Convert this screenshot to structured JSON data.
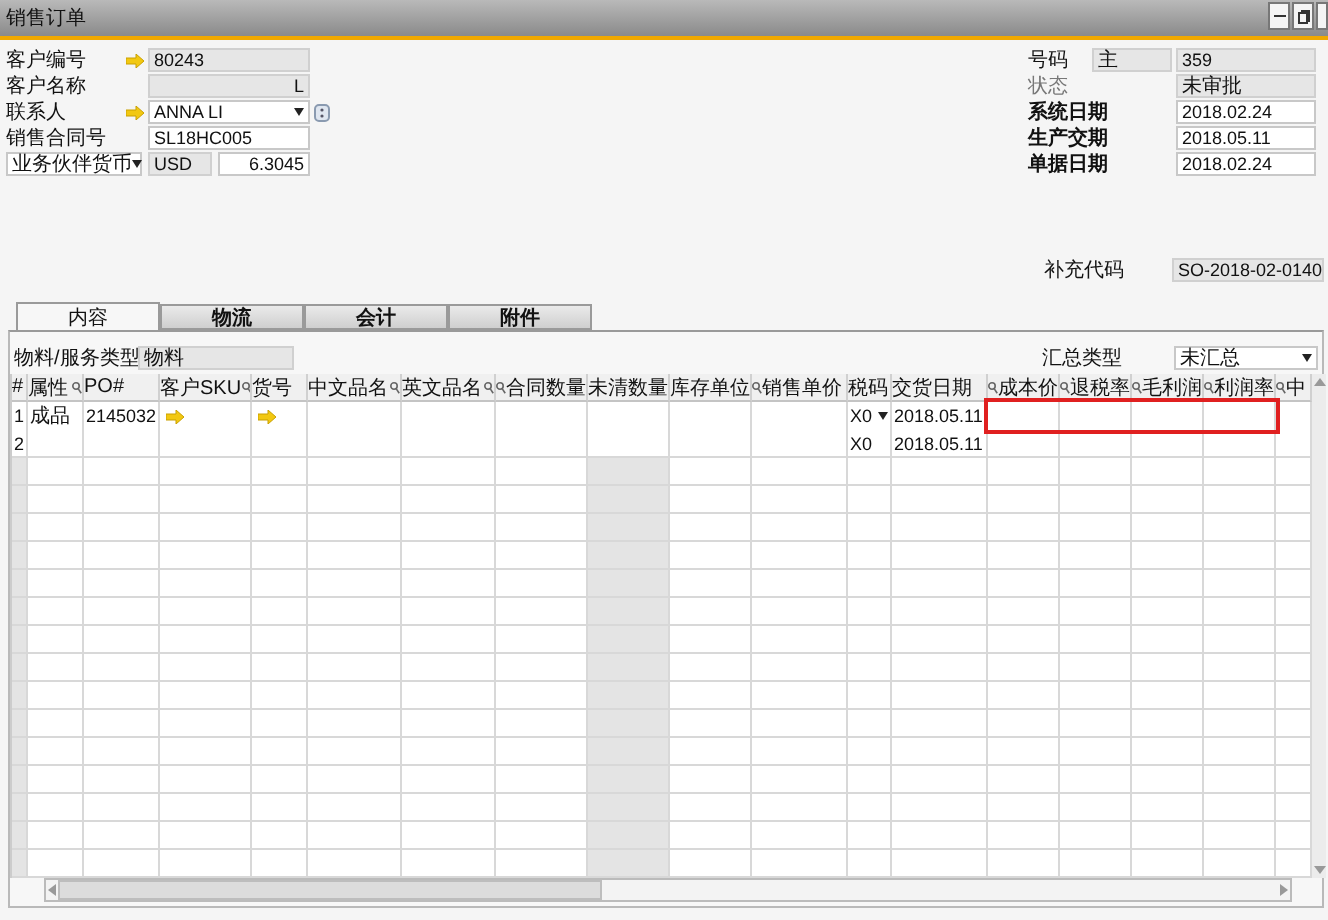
{
  "window": {
    "title": "销售订单"
  },
  "left_fields": [
    {
      "label": "客户编号",
      "kind": "link",
      "value": "80243"
    },
    {
      "label": "客户名称",
      "kind": "readonly_right",
      "value": "L"
    },
    {
      "label": "联系人",
      "kind": "link_dropdown",
      "value": "ANNA LI"
    },
    {
      "label": "销售合同号",
      "kind": "input",
      "value": "SL18HC005"
    },
    {
      "label": "业务伙伴货币",
      "kind": "currency",
      "value": "USD",
      "rate": "6.3045"
    }
  ],
  "right_fields": [
    {
      "label": "号码",
      "kind": "series",
      "series": "主",
      "value": "359"
    },
    {
      "label": "状态",
      "kind": "readonly",
      "value": "未审批"
    },
    {
      "label": "系统日期",
      "kind": "input",
      "value": "2018.02.24"
    },
    {
      "label": "生产交期",
      "kind": "input",
      "value": "2018.05.11"
    },
    {
      "label": "单据日期",
      "kind": "input",
      "value": "2018.02.24"
    }
  ],
  "extra_code": {
    "label": "补充代码",
    "value": "SO-2018-02-0140"
  },
  "tabs": [
    {
      "label": "内容",
      "selected": true
    },
    {
      "label": "物流",
      "selected": false
    },
    {
      "label": "会计",
      "selected": false
    },
    {
      "label": "附件",
      "selected": false
    }
  ],
  "item_type": {
    "label": "物料/服务类型",
    "value": "物料"
  },
  "summary_type": {
    "label": "汇总类型",
    "value": "未汇总"
  },
  "table": {
    "columns": [
      {
        "label": "#"
      },
      {
        "label": "属性",
        "search_right": true
      },
      {
        "label": "PO#"
      },
      {
        "label": "客户SKU",
        "search_right": true
      },
      {
        "label": "货号"
      },
      {
        "label": "中文品名",
        "search_right": true
      },
      {
        "label": "英文品名",
        "search_right": true
      },
      {
        "label": "合同数量",
        "search_left": true
      },
      {
        "label": "未清数量"
      },
      {
        "label": "库存单位"
      },
      {
        "label": "销售单价",
        "search_left": true
      },
      {
        "label": "税码"
      },
      {
        "label": "交货日期"
      },
      {
        "label": "成本价",
        "search_left": true
      },
      {
        "label": "退税率",
        "search_left": true
      },
      {
        "label": "毛利润",
        "search_left": true
      },
      {
        "label": "利润率",
        "search_left": true
      },
      {
        "label": "中",
        "search_left": true
      }
    ],
    "rows": [
      {
        "num": "1",
        "attribute": "成品",
        "po": "2145032",
        "sku_link": true,
        "item_link": true,
        "tax": "X0",
        "tax_dropdown": true,
        "date": "2018.05.11",
        "highlighted": true
      },
      {
        "num": "2",
        "tax": "X0",
        "sku_link": false,
        "item_link": false,
        "tax_dropdown": false,
        "date": "2018.05.11",
        "highlighted": false
      }
    ]
  }
}
